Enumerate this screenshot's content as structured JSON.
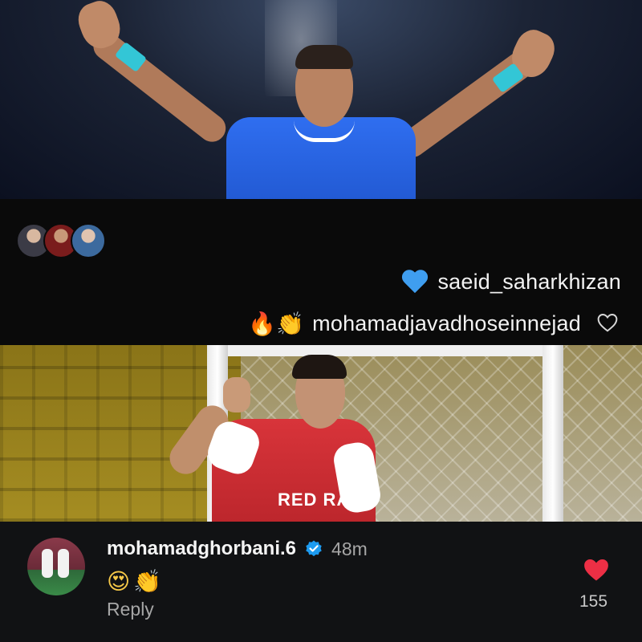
{
  "band": {
    "reactions": [
      {
        "emoji": "",
        "icon": "blue-heart-icon",
        "username": "saeid_saharkhizan"
      },
      {
        "emoji": "🔥👏",
        "icon": "fire-clap-emoji",
        "username": "mohamadjavadhoseinnejad"
      }
    ],
    "like_icon": "outline-heart-icon"
  },
  "photo_bottom": {
    "sponsor_text": "RED RAN"
  },
  "comment": {
    "username": "mohamadghorbani.6",
    "verified": true,
    "time": "48m",
    "text": "😍👏",
    "reply_label": "Reply",
    "likes": "155",
    "like_color": "#ed2f45"
  }
}
